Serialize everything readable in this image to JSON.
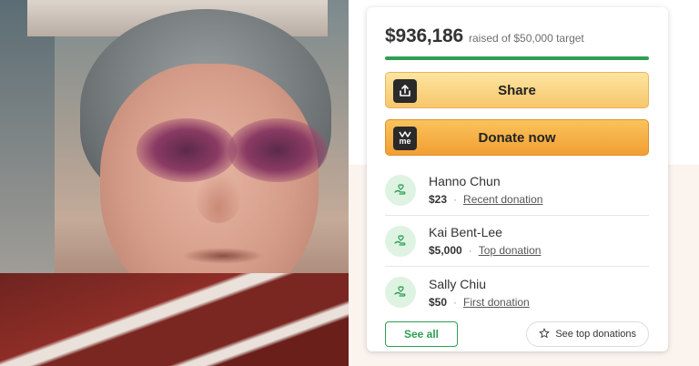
{
  "photo": {
    "alt": "Photo of an elderly woman with bruised eyes"
  },
  "fundraiser": {
    "amount_raised": "$936,186",
    "target_text": "raised of $50,000 target",
    "progress_fraction": 1.0,
    "accent_color": "#2f9e55"
  },
  "buttons": {
    "share_label": "Share",
    "donate_label": "Donate now",
    "donate_icon_text": "me"
  },
  "donations": [
    {
      "name": "Hanno Chun",
      "amount": "$23",
      "type": "Recent donation"
    },
    {
      "name": "Kai Bent-Lee",
      "amount": "$5,000",
      "type": "Top donation"
    },
    {
      "name": "Sally Chiu",
      "amount": "$50",
      "type": "First donation"
    }
  ],
  "footer": {
    "see_all_label": "See all",
    "see_top_label": "See top donations"
  },
  "icons": {
    "share": "share-icon",
    "donate": "gofundme-logo-icon",
    "avatar": "donor-hand-icon",
    "star": "star-icon"
  }
}
